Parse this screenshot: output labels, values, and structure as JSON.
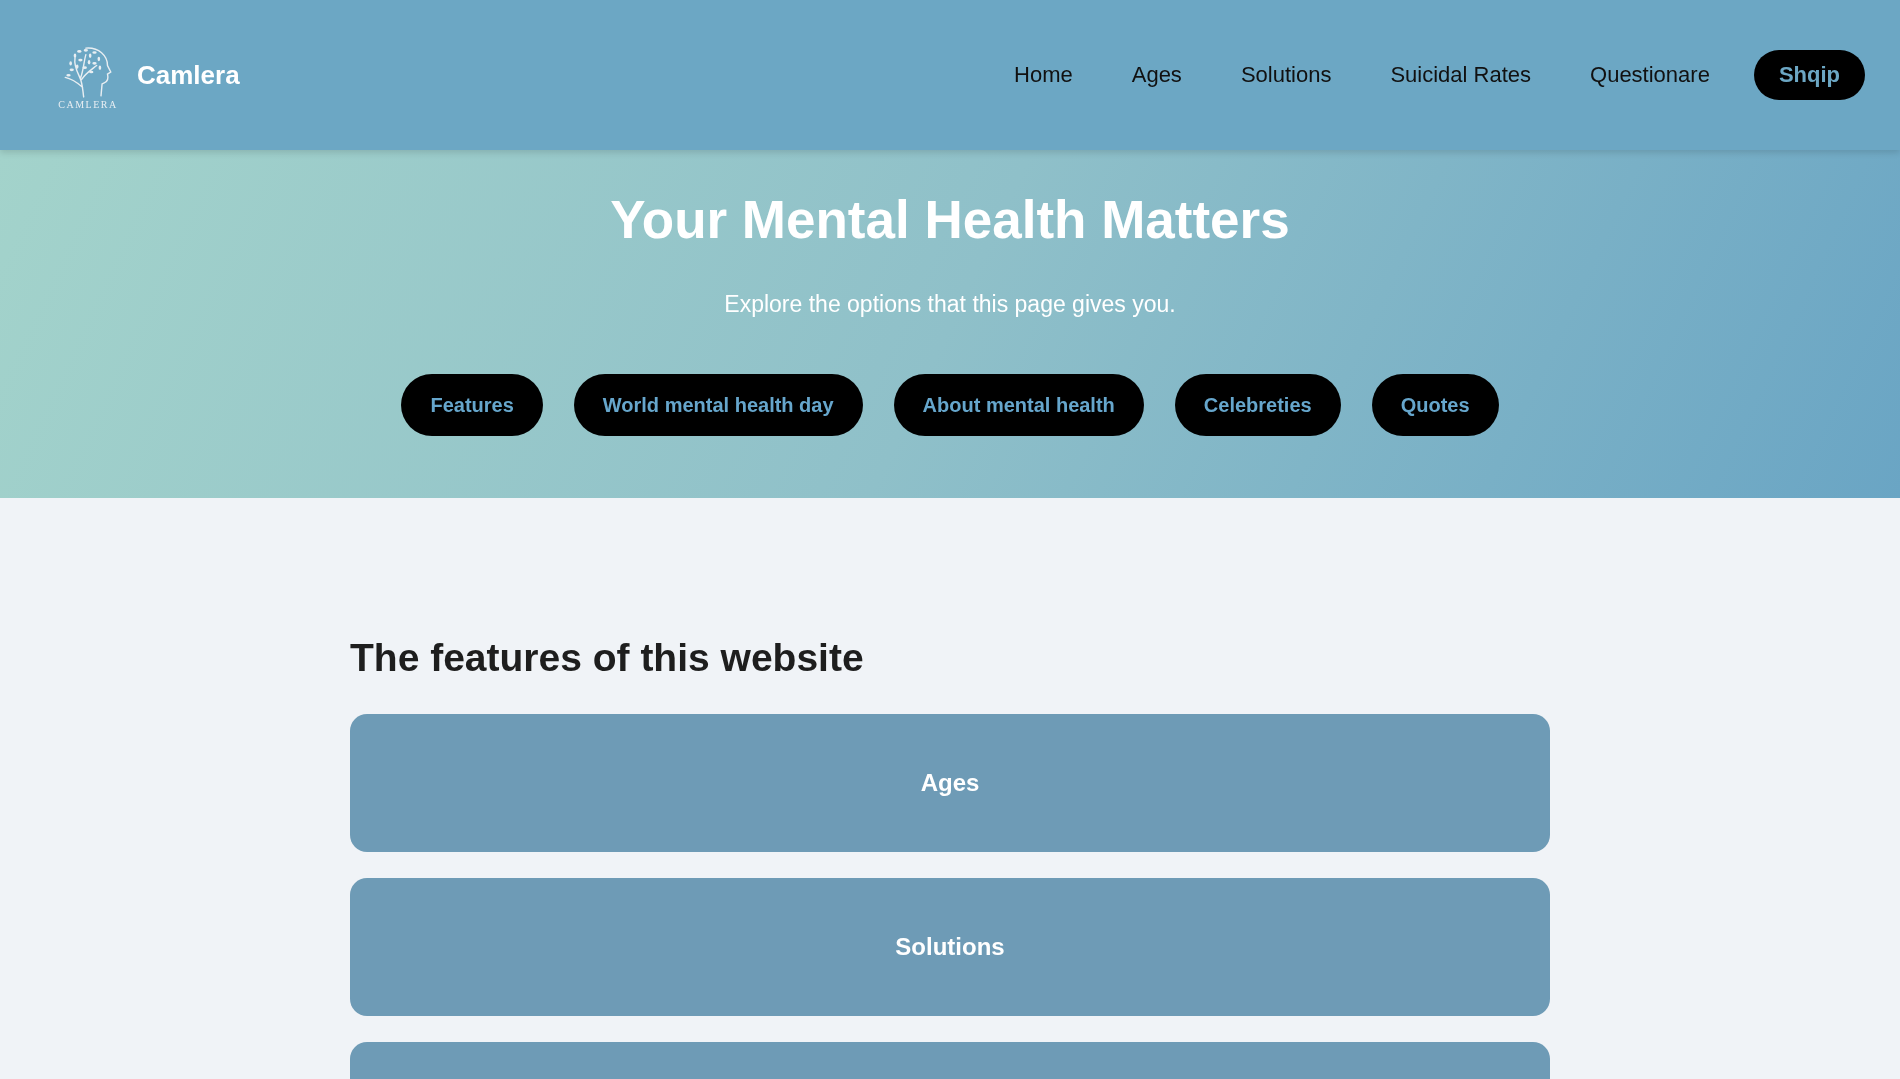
{
  "header": {
    "logo_caption": "CAMLERA",
    "brand": "Camlera",
    "nav": [
      {
        "label": "Home",
        "kind": "link"
      },
      {
        "label": "Ages",
        "kind": "link"
      },
      {
        "label": "Solutions",
        "kind": "link"
      },
      {
        "label": "Suicidal Rates",
        "kind": "link"
      },
      {
        "label": "Questionare",
        "kind": "link"
      },
      {
        "label": "Shqip",
        "kind": "button"
      }
    ]
  },
  "hero": {
    "title": "Your Mental Health Matters",
    "subtitle": "Explore the options that this page gives you.",
    "buttons": [
      "Features",
      "World mental health day",
      "About mental health",
      "Celebreties",
      "Quotes"
    ]
  },
  "features": {
    "heading": "The features of this website",
    "cards": [
      {
        "kind": "full",
        "label": "Ages"
      },
      {
        "kind": "full",
        "label": "Solutions"
      },
      {
        "kind": "cut"
      }
    ]
  }
}
